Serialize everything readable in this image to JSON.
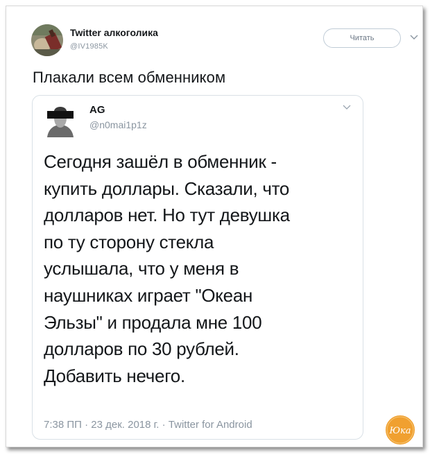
{
  "tweet": {
    "author_name": "Twitter алкоголика",
    "author_handle": "@IV1985K",
    "follow_label": "Читать",
    "text": "Плакали всем обменником"
  },
  "quoted": {
    "author_name": "AG",
    "author_handle": "@n0mai1p1z",
    "body": "Сегодня зашёл в обменник -\nкупить доллары. Сказали, что\nдолларов нет. Но тут девушка\nпо ту сторону стекла\nуслышала, что у меня в\nнаушниках играет \"Океан\nЭльзы\" и продала мне 100\nдолларов по 30 рублей.\nДобавить нечего.",
    "meta": "7:38 ПП · 23 дек. 2018 г. · Twitter for Android"
  },
  "watermark": {
    "logo_text": "Юка",
    "color": "#f0a030"
  },
  "icons": {
    "menu": "chevron-down-icon",
    "follow": "follow-button"
  }
}
